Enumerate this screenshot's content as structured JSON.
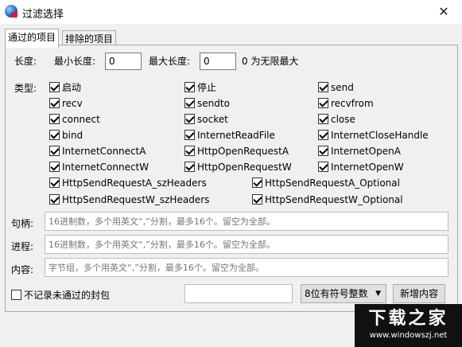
{
  "window": {
    "title": "过滤选择",
    "close_glyph": "✕"
  },
  "tabs": [
    {
      "label": "通过的项目"
    },
    {
      "label": "排除的项目"
    }
  ],
  "length": {
    "label": "长度:",
    "min_label": "最小长度:",
    "min_value": "0",
    "max_label": "最大长度:",
    "max_value": "0",
    "hint": "0 为无限最大"
  },
  "types": {
    "label": "类型:",
    "items": [
      {
        "label": "启动",
        "checked": true
      },
      {
        "label": "停止",
        "checked": true
      },
      {
        "label": "send",
        "checked": true
      },
      {
        "label": "recv",
        "checked": true
      },
      {
        "label": "sendto",
        "checked": true
      },
      {
        "label": "recvfrom",
        "checked": true
      },
      {
        "label": "connect",
        "checked": true
      },
      {
        "label": "socket",
        "checked": true
      },
      {
        "label": "close",
        "checked": true
      },
      {
        "label": "bind",
        "checked": true
      },
      {
        "label": "InternetReadFile",
        "checked": true
      },
      {
        "label": "InternetCloseHandle",
        "checked": true
      },
      {
        "label": "InternetConnectA",
        "checked": true
      },
      {
        "label": "HttpOpenRequestA",
        "checked": true
      },
      {
        "label": "InternetOpenA",
        "checked": true
      },
      {
        "label": "InternetConnectW",
        "checked": true
      },
      {
        "label": "HttpOpenRequestW",
        "checked": true
      },
      {
        "label": "InternetOpenW",
        "checked": true
      },
      {
        "label": "HttpSendRequestA_szHeaders",
        "checked": true
      },
      {
        "label": "HttpSendRequestA_Optional",
        "checked": true
      },
      {
        "label": "HttpSendRequestW_szHeaders",
        "checked": true
      },
      {
        "label": "HttpSendRequestW_Optional",
        "checked": true
      }
    ]
  },
  "handle": {
    "label": "句柄:",
    "placeholder": "16进制数，多个用英文“,”分割，最多16个。留空为全部。"
  },
  "process": {
    "label": "进程:",
    "placeholder": "16进制数，多个用英文“,”分割，最多16个。留空为全部。"
  },
  "content": {
    "label": "内容:",
    "placeholder": "字节组，多个用英文“,”分割，最多16个。留空为全部。"
  },
  "bottom": {
    "no_record_label": "不记录未通过的封包",
    "no_record_checked": false,
    "input_value": "",
    "select_value": "8位有符号整数",
    "add_button": "新增内容"
  },
  "watermark": {
    "big": "下载之家",
    "small": "www.windowszj.net"
  }
}
